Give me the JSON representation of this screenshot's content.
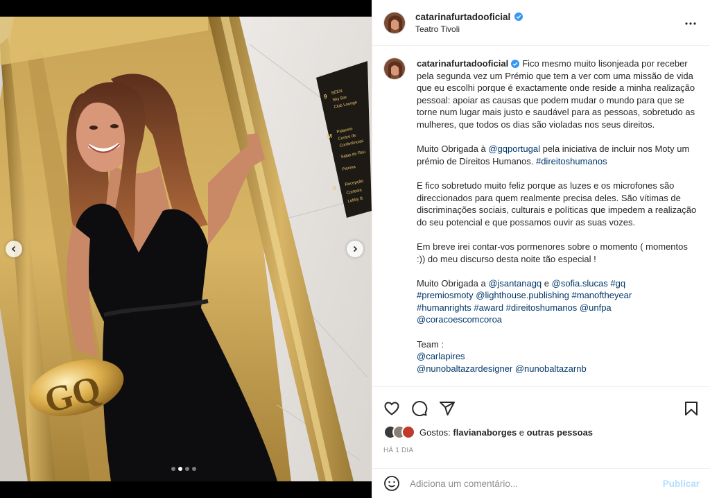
{
  "post": {
    "username": "catarinafurtadooficial",
    "location": "Teatro Tivoli",
    "verified": true,
    "more_icon": "more-horizontal-icon"
  },
  "photo": {
    "alt": "Woman in black velvet dress holding a gold GQ trophy in an elevator",
    "carousel_index": 2,
    "carousel_count": 4,
    "sign_lines": [
      "SEEN",
      "Sky Bar",
      "Club Lounge",
      "Palacete",
      "Centro de",
      "Conferências",
      "Salas de Reu",
      "Piscina",
      "Recepção",
      "Cortesia",
      "Lobby B"
    ],
    "sign_floors": [
      "9",
      "M",
      "0"
    ],
    "trophy_text": "GQ"
  },
  "caption": {
    "p1_text": "Fico mesmo muito lisonjeada por receber pela segunda vez um Prémio que tem a ver com uma missão de vida que eu escolhi porque é exactamente onde reside a minha realização pessoal: apoiar as causas que podem mudar o mundo para que se torne num lugar mais justo e saudável para as pessoas, sobretudo as mulheres, que todos os dias são violadas nos seus direitos.",
    "p2_a": "Muito Obrigada à ",
    "p2_mention": "@gqportugal",
    "p2_b": " pela iniciativa de incluir nos Moty um prémio de Direitos Humanos. ",
    "p2_tag": "#direitoshumanos",
    "p3_text": "E fico sobretudo muito feliz porque as luzes e os microfones são direccionados para quem realmente precisa deles. São vítimas de discriminações sociais, culturais e políticas que impedem a realização do seu potencial e que possamos ouvir as suas vozes.",
    "p4_text": "Em breve irei contar-vos pormenores sobre o momento ( momentos :)) do meu discurso desta noite tão especial !",
    "p5_a": "Muito Obrigada a ",
    "p5_m1": "@jsantanagq",
    "p5_b": " e ",
    "p5_m2": "@sofia.slucas",
    "p5_t1": "#gq",
    "p5_t2": "#premiosmoty",
    "p5_m3": "@lighthouse.publishing",
    "p5_t3": "#manoftheyear",
    "p5_t4": "#humanrights",
    "p5_t5": "#award",
    "p5_t6": "#direitoshumanos",
    "p5_m4": "@unfpa",
    "p5_m5": "@coracoescomcoroa",
    "team_label": "Team :",
    "team_m1": "@carlapires",
    "team_m2": "@nunobaltazardesigner",
    "team_m3": "@nunobaltazarnb"
  },
  "actions": {
    "like_icon": "heart-icon",
    "comment_icon": "comment-icon",
    "share_icon": "share-icon",
    "save_icon": "bookmark-icon"
  },
  "likes": {
    "prefix": "Gostos: ",
    "user": "flavianaborges",
    "suffix": " e ",
    "others": "outras pessoas"
  },
  "timestamp": "HÁ 1 DIA",
  "comment": {
    "placeholder": "Adiciona um comentário...",
    "publish_label": "Publicar",
    "emoji_icon": "emoji-icon"
  },
  "colors": {
    "accent_blue": "#0095f6",
    "link_blue": "#00376b",
    "verified_blue": "#3897f0",
    "publish_disabled": "#b2dffc"
  }
}
